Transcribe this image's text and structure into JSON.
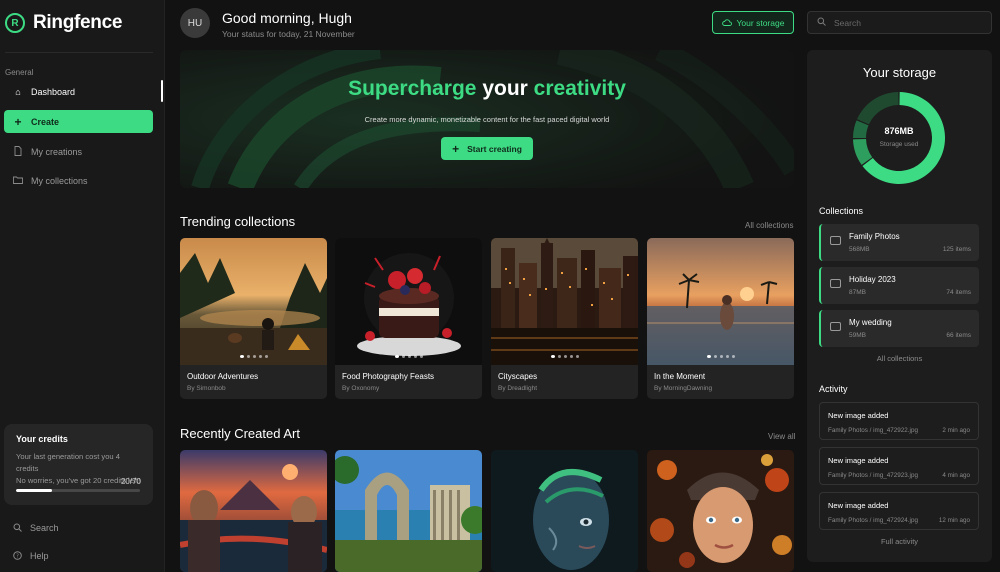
{
  "app": {
    "name": "Ringfence",
    "logo_glyph": "R",
    "accent": "#3ddc84"
  },
  "sidebar": {
    "section_label": "General",
    "items": [
      {
        "label": "Dashboard",
        "icon": "home-icon"
      },
      {
        "label": "Create",
        "icon": "plus-icon"
      },
      {
        "label": "My creations",
        "icon": "document-icon"
      },
      {
        "label": "My collections",
        "icon": "folder-icon"
      }
    ],
    "credits": {
      "title": "Your credits",
      "line1": "Your last generation cost you 4 credits",
      "line2": "No worries, you've got 20 credits left!",
      "count": "20/70",
      "fraction": 0.29
    },
    "footer": [
      {
        "label": "Search",
        "icon": "search-icon"
      },
      {
        "label": "Help",
        "icon": "help-icon"
      }
    ]
  },
  "header": {
    "avatar_initials": "HU",
    "greeting": "Good morning, Hugh",
    "status": "Your status for today, 21 November",
    "storage_button": "Your storage",
    "search_placeholder": "Search"
  },
  "hero": {
    "title_part1": "Supercharge",
    "title_part2": " your ",
    "title_part3": "creativity",
    "subtitle": "Create more dynamic, monetizable content for the fast paced digital world",
    "button": "Start creating"
  },
  "trending": {
    "title": "Trending collections",
    "link": "All collections",
    "cards": [
      {
        "title": "Outdoor Adventures",
        "author": "By Simonbob"
      },
      {
        "title": "Food Photography Feasts",
        "author": "By Oxonomy"
      },
      {
        "title": "Cityscapes",
        "author": "By Dreadlight"
      },
      {
        "title": "In the Moment",
        "author": "By MorningDawning"
      }
    ]
  },
  "recent": {
    "title": "Recently Created Art",
    "link": "View all"
  },
  "storage": {
    "title": "Your storage",
    "value": "876MB",
    "label": "Storage used",
    "segments": [
      {
        "name": "Family Photos",
        "value": 568,
        "color": "#3ddc84"
      },
      {
        "name": "Holiday 2023",
        "value": 87,
        "color": "#2e9e5e"
      },
      {
        "name": "My wedding",
        "value": 59,
        "color": "#226b42"
      },
      {
        "name": "Free",
        "value": 162,
        "color": "#1f4a30"
      }
    ]
  },
  "collections": {
    "title": "Collections",
    "items": [
      {
        "name": "Family Photos",
        "size": "568MB",
        "count": "125 items"
      },
      {
        "name": "Holiday 2023",
        "size": "87MB",
        "count": "74 items"
      },
      {
        "name": "My wedding",
        "size": "59MB",
        "count": "66 items"
      }
    ],
    "link": "All collections"
  },
  "activity": {
    "title": "Activity",
    "items": [
      {
        "title": "New image added",
        "path": "Family Photos / img_472922.jpg",
        "time": "2 min ago"
      },
      {
        "title": "New image added",
        "path": "Family Photos / img_472923.jpg",
        "time": "4 min ago"
      },
      {
        "title": "New image added",
        "path": "Family Photos / img_472924.jpg",
        "time": "12 min ago"
      }
    ],
    "link": "Full activity"
  }
}
